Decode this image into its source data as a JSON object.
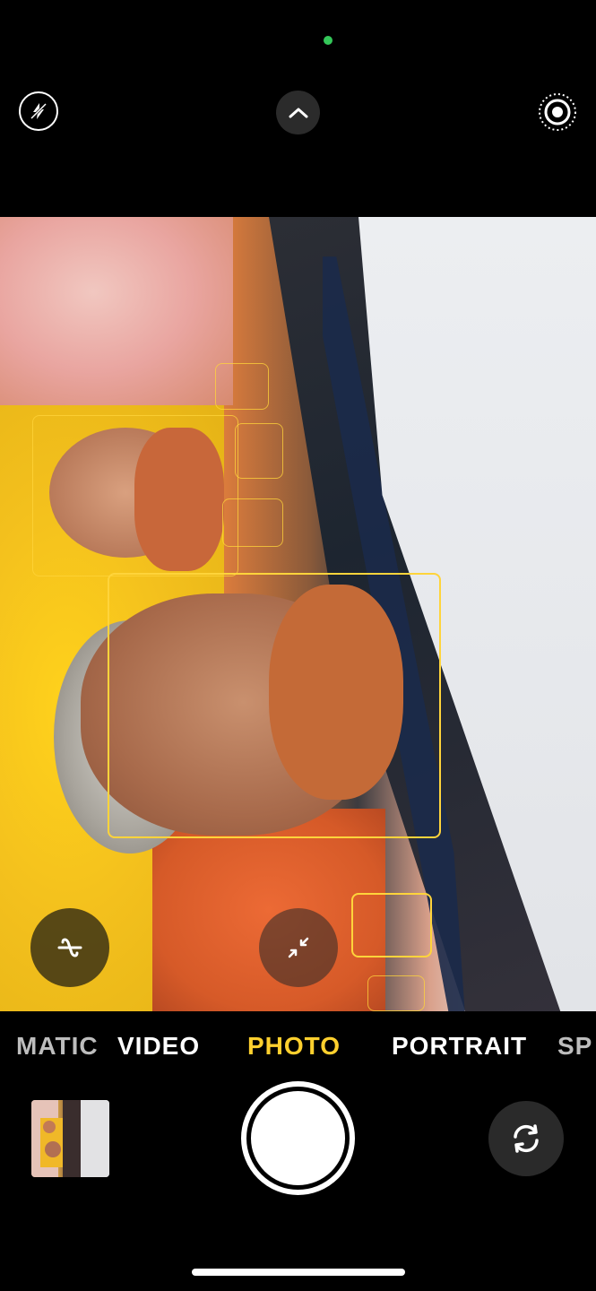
{
  "colors": {
    "accent_yellow": "#ffd02e",
    "face_box": "#ffd43b",
    "privacy_indicator": "#34c759",
    "background": "#000000"
  },
  "top_controls": {
    "flash_icon": "lightning-bolt-off",
    "chevron_icon": "chevron-up",
    "live_icon": "live-photo-circles"
  },
  "viewfinder": {
    "subject_description_icons": [
      "shutter-speed-icon",
      "zoom-arrows-icon"
    ]
  },
  "modes": {
    "items": [
      {
        "label": "MATIC",
        "state": "partial"
      },
      {
        "label": "VIDEO",
        "state": "normal"
      },
      {
        "label": "PHOTO",
        "state": "active"
      },
      {
        "label": "PORTRAIT",
        "state": "normal"
      },
      {
        "label": "SP",
        "state": "partial"
      }
    ]
  },
  "bottom_controls": {
    "thumbnail_icon": "last-photo-thumbnail",
    "shutter_icon": "shutter-button",
    "flip_icon": "flip-camera-icon"
  }
}
